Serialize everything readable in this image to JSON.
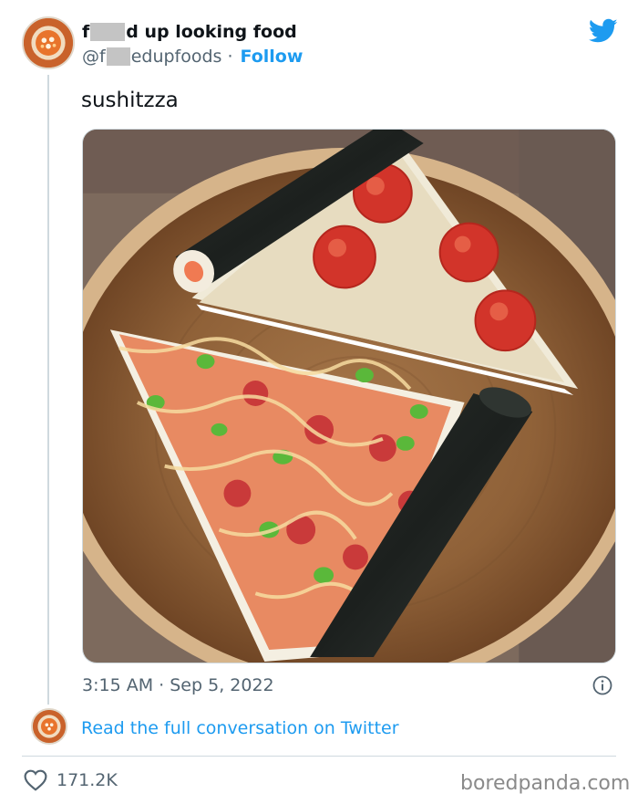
{
  "author": {
    "name_prefix": "f",
    "name_suffix": "d up looking food",
    "handle_prefix": "@f",
    "handle_suffix": "edupfoods",
    "separator": "·",
    "follow_label": "Follow"
  },
  "tweet": {
    "text": "sushitzza",
    "time": "3:15 AM",
    "date": "Sep 5, 2022",
    "separator": "·"
  },
  "conversation_link": "Read the full conversation on Twitter",
  "likes": {
    "count": "171.2K"
  },
  "watermark": "boredpanda.com",
  "colors": {
    "accent": "#1d9bf0",
    "muted": "#536471",
    "text": "#0f1419"
  },
  "icons": [
    "twitter-bird-icon",
    "info-icon",
    "heart-icon"
  ]
}
